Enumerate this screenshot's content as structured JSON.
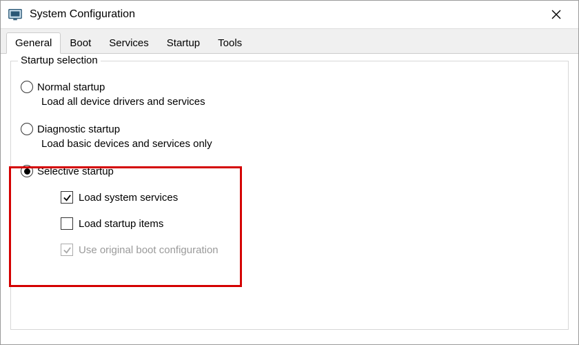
{
  "window": {
    "title": "System Configuration"
  },
  "tabs": {
    "general": "General",
    "boot": "Boot",
    "services": "Services",
    "startup": "Startup",
    "tools": "Tools"
  },
  "groupbox": {
    "title": "Startup selection"
  },
  "options": {
    "normal": {
      "label": "Normal startup",
      "desc": "Load all device drivers and services"
    },
    "diagnostic": {
      "label": "Diagnostic startup",
      "desc": "Load basic devices and services only"
    },
    "selective": {
      "label": "Selective startup",
      "sub": {
        "services": "Load system services",
        "startup_items": "Load startup items",
        "original_boot": "Use original boot configuration"
      }
    }
  }
}
